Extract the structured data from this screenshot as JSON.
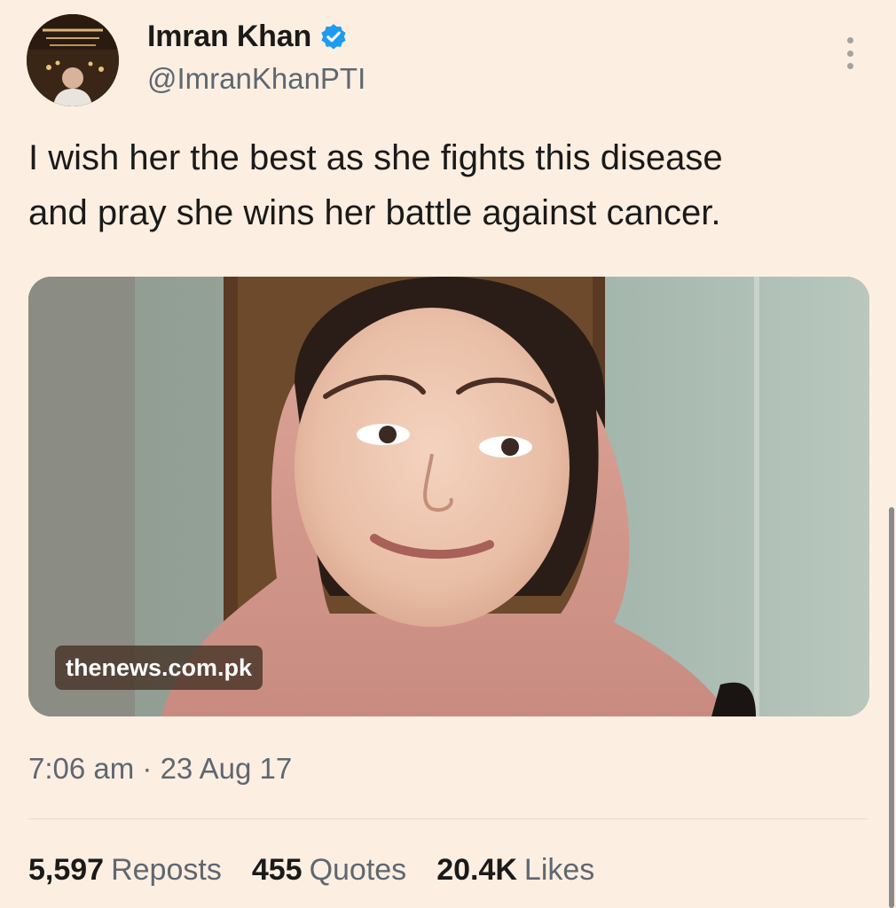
{
  "user": {
    "display_name": "Imran Khan",
    "handle": "@ImranKhanPTI",
    "verified": true,
    "verified_color": "#1d9bf0"
  },
  "tweet": {
    "text": "I wish her the best as she fights this disease\nand pray she wins her battle against cancer.",
    "media_source": "thenews.com.pk",
    "timestamp": "7:06 am · 23 Aug 17"
  },
  "stats": {
    "reposts_count": "5,597",
    "reposts_label": "Reposts",
    "quotes_count": "455",
    "quotes_label": "Quotes",
    "likes_count": "20.4K",
    "likes_label": "Likes"
  },
  "icons": {
    "verified": "verified-badge-icon",
    "more": "more-options-icon"
  },
  "colors": {
    "background": "#fcefe2",
    "secondary_text": "#5f6770"
  }
}
